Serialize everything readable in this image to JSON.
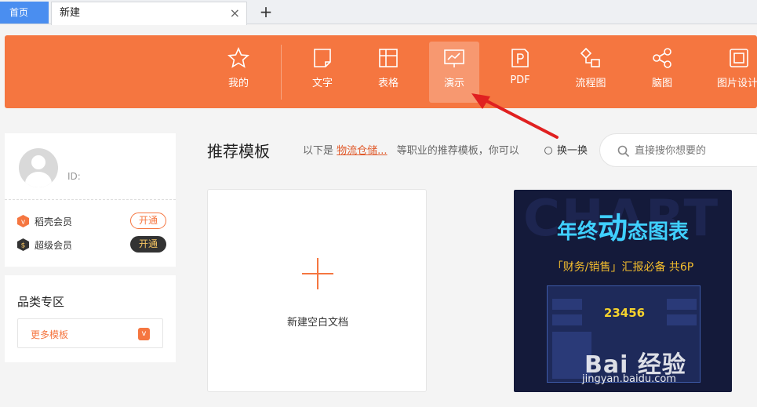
{
  "tabs": {
    "home_label": "首页",
    "active_label": "新建",
    "close_glyph": "×",
    "add_glyph": "+"
  },
  "toolbar": {
    "accent_color": "#f57640",
    "items": [
      {
        "label": "我的",
        "icon": "star-icon"
      },
      {
        "label": "文字",
        "icon": "document-icon"
      },
      {
        "label": "表格",
        "icon": "table-icon"
      },
      {
        "label": "演示",
        "icon": "presentation-icon",
        "active": true
      },
      {
        "label": "PDF",
        "icon": "pdf-icon"
      },
      {
        "label": "流程图",
        "icon": "flowchart-icon"
      },
      {
        "label": "脑图",
        "icon": "mindmap-icon"
      },
      {
        "label": "图片设计",
        "icon": "image-design-icon"
      }
    ]
  },
  "user": {
    "id_label": "ID:",
    "members": [
      {
        "name": "稻壳会员",
        "button": "开通",
        "icon": "docer-member-icon"
      },
      {
        "name": "超级会员",
        "button": "开通",
        "icon": "super-member-icon"
      }
    ]
  },
  "category": {
    "title": "品类专区",
    "more_label": "更多模板",
    "more_icon": "docer-icon"
  },
  "main": {
    "title": "推荐模板",
    "sub_prefix": "以下是",
    "sub_job": "物流仓储...",
    "sub_suffix": "等职业的推荐模板，你可以",
    "swap_label": "换一换",
    "search_placeholder": "直接搜你想要的",
    "blank_label": "新建空白文档"
  },
  "template": {
    "bg_text": "CHART",
    "title_pre": "年终",
    "title_big": "动",
    "title_post": "态图表",
    "subtitle": "「财务/销售」汇报必备  共6P",
    "number": "23456"
  },
  "watermark": {
    "main": "Bai  经验",
    "url": "jingyan.baidu.com"
  }
}
